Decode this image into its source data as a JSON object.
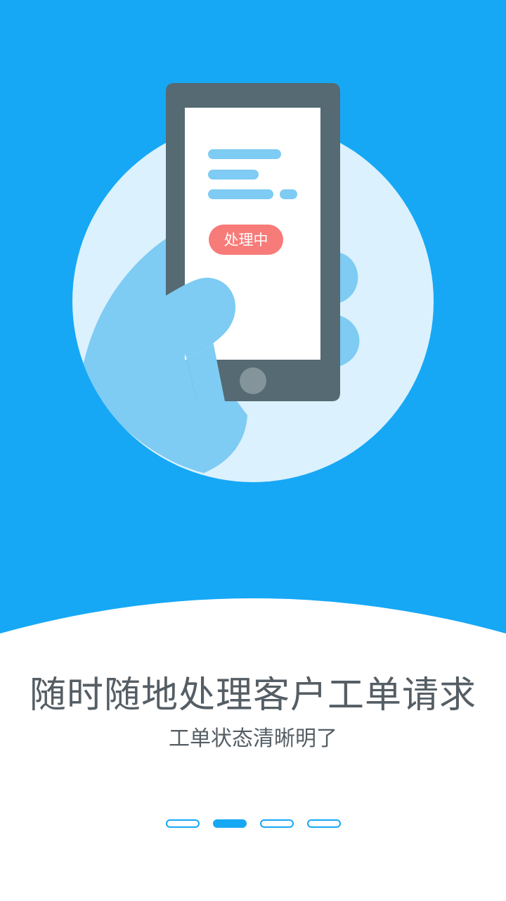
{
  "colors": {
    "background_blue": "#16a8f5",
    "circle_light": "#dbf1fd",
    "hand": "#7ecbf3",
    "phone_body": "#556a72",
    "badge": "#f77b78",
    "text": "#555e64",
    "dot_active": "#16a8f5"
  },
  "illustration": {
    "badge_text": "处理中"
  },
  "onboarding": {
    "title": "随时随地处理客户工单请求",
    "subtitle": "工单状态清晰明了"
  },
  "pager": {
    "total": 4,
    "active_index": 1
  }
}
